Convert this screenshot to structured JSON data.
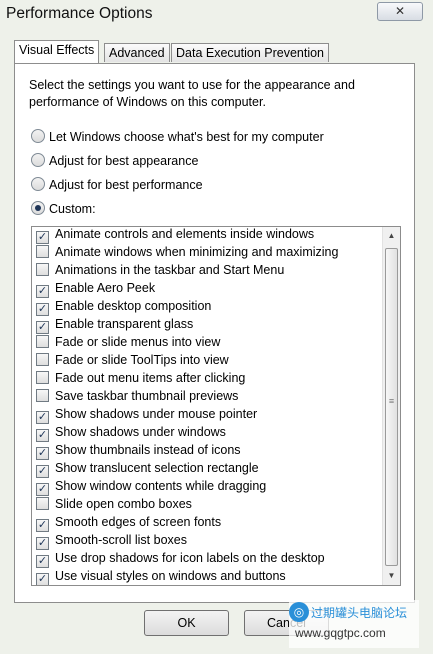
{
  "window": {
    "title": "Performance Options",
    "close_glyph": "✕"
  },
  "tabs": [
    {
      "label": "Visual Effects",
      "active": true
    },
    {
      "label": "Advanced",
      "active": false
    },
    {
      "label": "Data Execution Prevention",
      "active": false
    }
  ],
  "panel": {
    "description": "Select the settings you want to use for the appearance and performance of Windows on this computer.",
    "radios": [
      {
        "label": "Let Windows choose what's best for my computer",
        "selected": false
      },
      {
        "label": "Adjust for best appearance",
        "selected": false
      },
      {
        "label": "Adjust for best performance",
        "selected": false
      },
      {
        "label": "Custom:",
        "selected": true
      }
    ],
    "effects": [
      {
        "label": "Animate controls and elements inside windows",
        "checked": true
      },
      {
        "label": "Animate windows when minimizing and maximizing",
        "checked": false
      },
      {
        "label": "Animations in the taskbar and Start Menu",
        "checked": false
      },
      {
        "label": "Enable Aero Peek",
        "checked": true
      },
      {
        "label": "Enable desktop composition",
        "checked": true
      },
      {
        "label": "Enable transparent glass",
        "checked": true
      },
      {
        "label": "Fade or slide menus into view",
        "checked": false
      },
      {
        "label": "Fade or slide ToolTips into view",
        "checked": false
      },
      {
        "label": "Fade out menu items after clicking",
        "checked": false
      },
      {
        "label": "Save taskbar thumbnail previews",
        "checked": false
      },
      {
        "label": "Show shadows under mouse pointer",
        "checked": true
      },
      {
        "label": "Show shadows under windows",
        "checked": true
      },
      {
        "label": "Show thumbnails instead of icons",
        "checked": true
      },
      {
        "label": "Show translucent selection rectangle",
        "checked": true
      },
      {
        "label": "Show window contents while dragging",
        "checked": true
      },
      {
        "label": "Slide open combo boxes",
        "checked": false
      },
      {
        "label": "Smooth edges of screen fonts",
        "checked": true
      },
      {
        "label": "Smooth-scroll list boxes",
        "checked": true
      },
      {
        "label": "Use drop shadows for icon labels on the desktop",
        "checked": true
      },
      {
        "label": "Use visual styles on windows and buttons",
        "checked": true
      }
    ]
  },
  "buttons": {
    "ok": "OK",
    "cancel": "Cancel"
  },
  "watermark": {
    "line1": "过期罐头电脑论坛",
    "line2": "www.gqgtpc.com"
  },
  "colors": {
    "window_bg": "#eef1ea",
    "check": "#1d3457",
    "watermark_blue": "#2a8fd8"
  }
}
